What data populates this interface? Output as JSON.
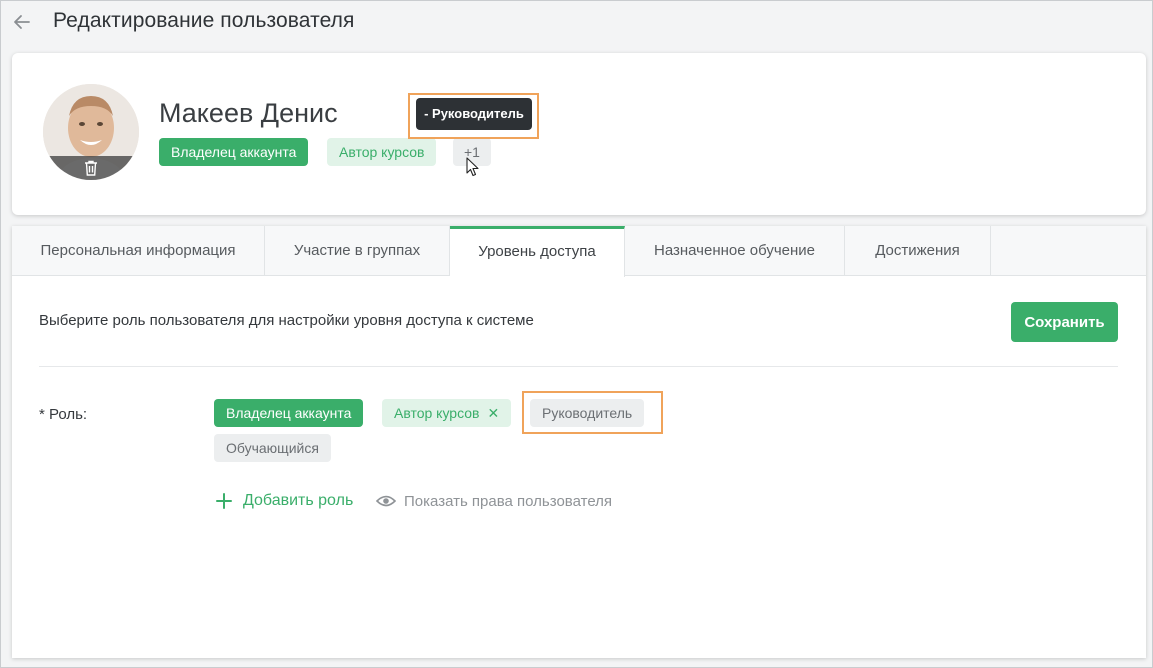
{
  "header": {
    "back_icon": "arrow-left-icon",
    "title": "Редактирование пользователя"
  },
  "profile": {
    "name": "Макеев Денис",
    "avatar_icon": "user-photo",
    "delete_icon": "trash-icon",
    "tags": [
      "Владелец аккаунта",
      "Автор курсов"
    ],
    "more_count": "+1",
    "tooltip": "- Руководитель"
  },
  "tabs": [
    {
      "label": "Персональная информация"
    },
    {
      "label": "Участие в группах"
    },
    {
      "label": "Уровень доступа",
      "active": true
    },
    {
      "label": "Назначенное обучение"
    },
    {
      "label": "Достижения"
    }
  ],
  "access": {
    "description": "Выберите роль пользователя для настройки уровня доступа к системе",
    "save_label": "Сохранить",
    "role_label": "* Роль:",
    "roles": [
      {
        "label": "Владелец аккаунта",
        "style": "selected-primary"
      },
      {
        "label": "Автор курсов",
        "style": "selected",
        "removable": true
      },
      {
        "label": "Руководитель",
        "style": "unselected"
      },
      {
        "label": "Обучающийся",
        "style": "unselected"
      }
    ],
    "add_role": "Добавить роль",
    "show_rights": "Показать права пользователя"
  },
  "colors": {
    "accent": "#3aae6a",
    "accent_light": "#e1f3e8",
    "highlight": "#f0a35a",
    "tooltip_bg": "#2d3135"
  }
}
